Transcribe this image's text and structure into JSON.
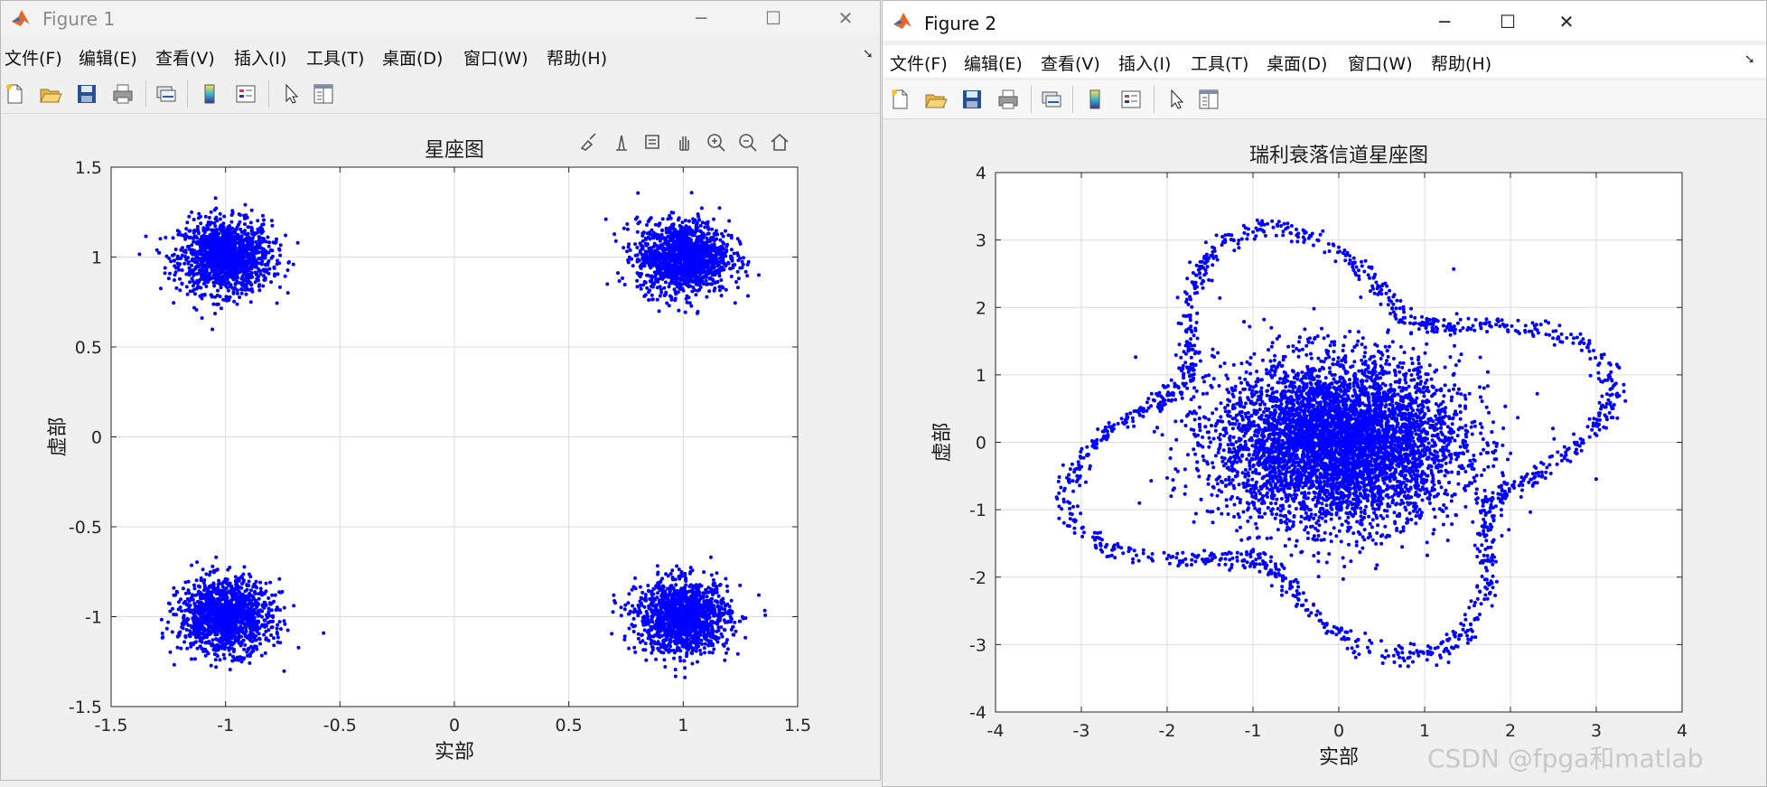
{
  "colors": {
    "marker": "#0000ff",
    "axes_bg": "#ffffff",
    "grid": "#dcdcdc",
    "window_bg": "#f0f0f0"
  },
  "figures": [
    {
      "title": "Figure 1",
      "menu": [
        "文件(F)",
        "编辑(E)",
        "查看(V)",
        "插入(I)",
        "工具(T)",
        "桌面(D)",
        "窗口(W)",
        "帮助(H)"
      ],
      "toolbar_icons": [
        "new-file-icon",
        "open-folder-icon",
        "save-icon",
        "print-icon",
        "link-plot-icon",
        "colorbar-icon",
        "legend-icon",
        "pointer-icon",
        "property-inspector-icon"
      ],
      "axes_toolbar_icons": [
        "brush-icon",
        "data-tips-icon",
        "datatip-icon",
        "pan-icon",
        "zoom-in-icon",
        "zoom-out-icon",
        "home-icon"
      ]
    },
    {
      "title": "Figure 2",
      "menu": [
        "文件(F)",
        "编辑(E)",
        "查看(V)",
        "插入(I)",
        "工具(T)",
        "桌面(D)",
        "窗口(W)",
        "帮助(H)"
      ],
      "toolbar_icons": [
        "new-file-icon",
        "open-folder-icon",
        "save-icon",
        "print-icon",
        "link-plot-icon",
        "colorbar-icon",
        "legend-icon",
        "pointer-icon",
        "property-inspector-icon"
      ]
    }
  ],
  "chart_data": [
    {
      "type": "scatter",
      "title": "星座图",
      "xlabel": "实部",
      "ylabel": "虚部",
      "xlim": [
        -1.5,
        1.5
      ],
      "ylim": [
        -1.5,
        1.5
      ],
      "xticks": [
        "-1.5",
        "-1",
        "-0.5",
        "0",
        "0.5",
        "1",
        "1.5"
      ],
      "yticks": [
        "-1.5",
        "-1",
        "-0.5",
        "0",
        "0.5",
        "1",
        "1.5"
      ],
      "grid": true,
      "marker_color": "#0000ff",
      "series": [
        {
          "x_center": -1,
          "y_center": 1,
          "spread": 0.1
        },
        {
          "x_center": 1,
          "y_center": 1,
          "spread": 0.1
        },
        {
          "x_center": -1,
          "y_center": -1,
          "spread": 0.1
        },
        {
          "x_center": 1,
          "y_center": -1,
          "spread": 0.1
        }
      ]
    },
    {
      "type": "scatter",
      "title": "瑞利衰落信道星座图",
      "xlabel": "实部",
      "ylabel": "虚部",
      "xlim": [
        -4,
        4
      ],
      "ylim": [
        -4,
        4
      ],
      "xticks": [
        "-4",
        "-3",
        "-2",
        "-1",
        "0",
        "1",
        "2",
        "3",
        "4"
      ],
      "yticks": [
        "-4",
        "-3",
        "-2",
        "-1",
        "0",
        "1",
        "2",
        "3",
        "4"
      ],
      "grid": true,
      "marker_color": "#0000ff",
      "core": {
        "x_center": 0,
        "y_center": 0,
        "spread_x": 0.7,
        "spread_y": 0.6
      },
      "outer_radius_range": [
        2.0,
        3.3
      ]
    }
  ],
  "watermark": "CSDN @fpga和matlab"
}
